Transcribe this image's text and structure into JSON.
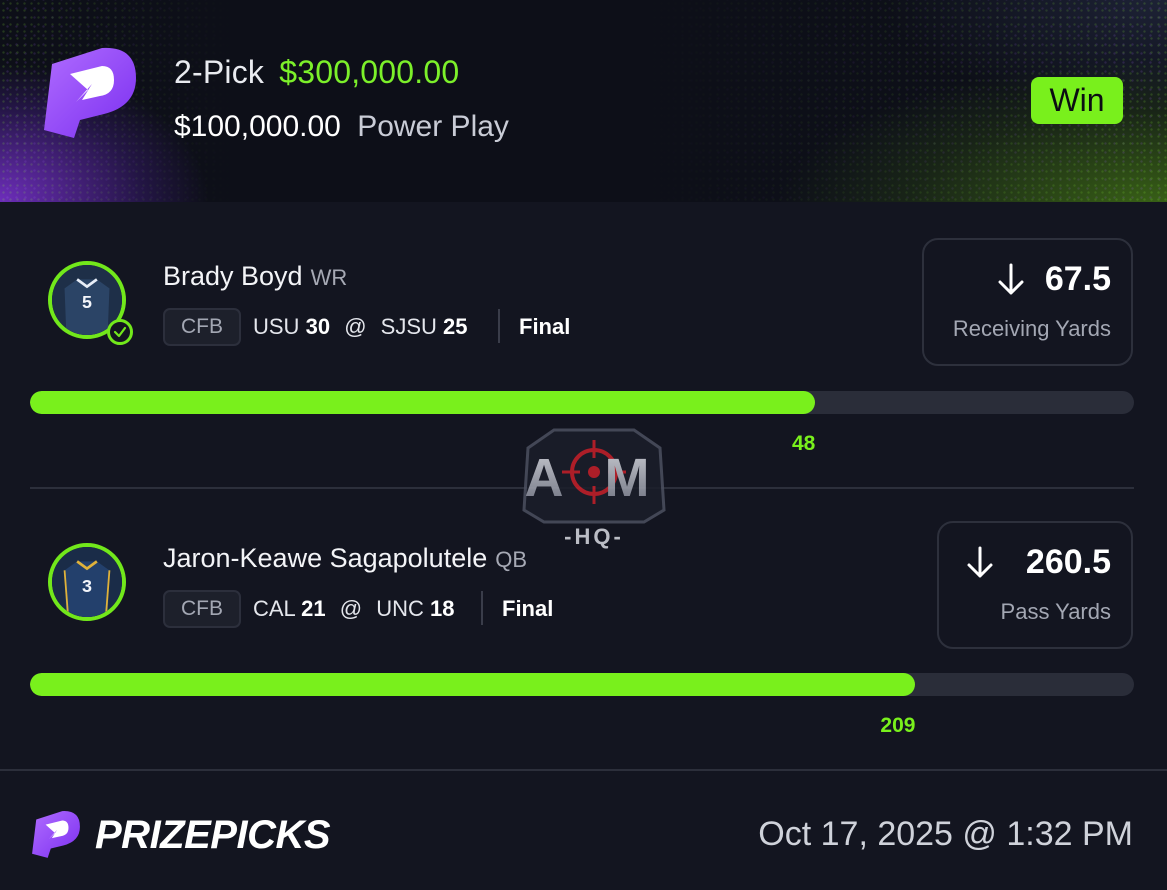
{
  "header": {
    "pick_count": "2-Pick",
    "payout": "$300,000.00",
    "entry_amount": "$100,000.00",
    "play_type": "Power Play",
    "result": "Win"
  },
  "picks": [
    {
      "player": "Brady Boyd",
      "position": "WR",
      "jersey_number": "5",
      "league": "CFB",
      "away_team": "USU",
      "away_score": "30",
      "home_team": "SJSU",
      "home_score": "25",
      "status": "Final",
      "line": "67.5",
      "stat": "Receiving Yards",
      "direction": "under",
      "actual": "48",
      "progress_fraction": 0.711,
      "hit": true
    },
    {
      "player": "Jaron-Keawe Sagapolutele",
      "position": "QB",
      "jersey_number": "3",
      "league": "CFB",
      "away_team": "CAL",
      "away_score": "21",
      "home_team": "UNC",
      "home_score": "18",
      "status": "Final",
      "line": "260.5",
      "stat": "Pass Yards",
      "direction": "under",
      "actual": "209",
      "progress_fraction": 0.802,
      "hit": false
    }
  ],
  "watermark": {
    "top": "A M",
    "bottom": "-HQ-"
  },
  "footer": {
    "brand": "PRIZEPICKS",
    "timestamp": "Oct 17, 2025 @ 1:32 PM"
  },
  "colors": {
    "accent_green": "#79f01c",
    "brand_purple": "#8b3cf0",
    "background": "#131520"
  },
  "icons": {
    "logo": "prizepicks-logo-icon",
    "direction": "arrow-down-icon",
    "hit": "check-circle-icon"
  }
}
